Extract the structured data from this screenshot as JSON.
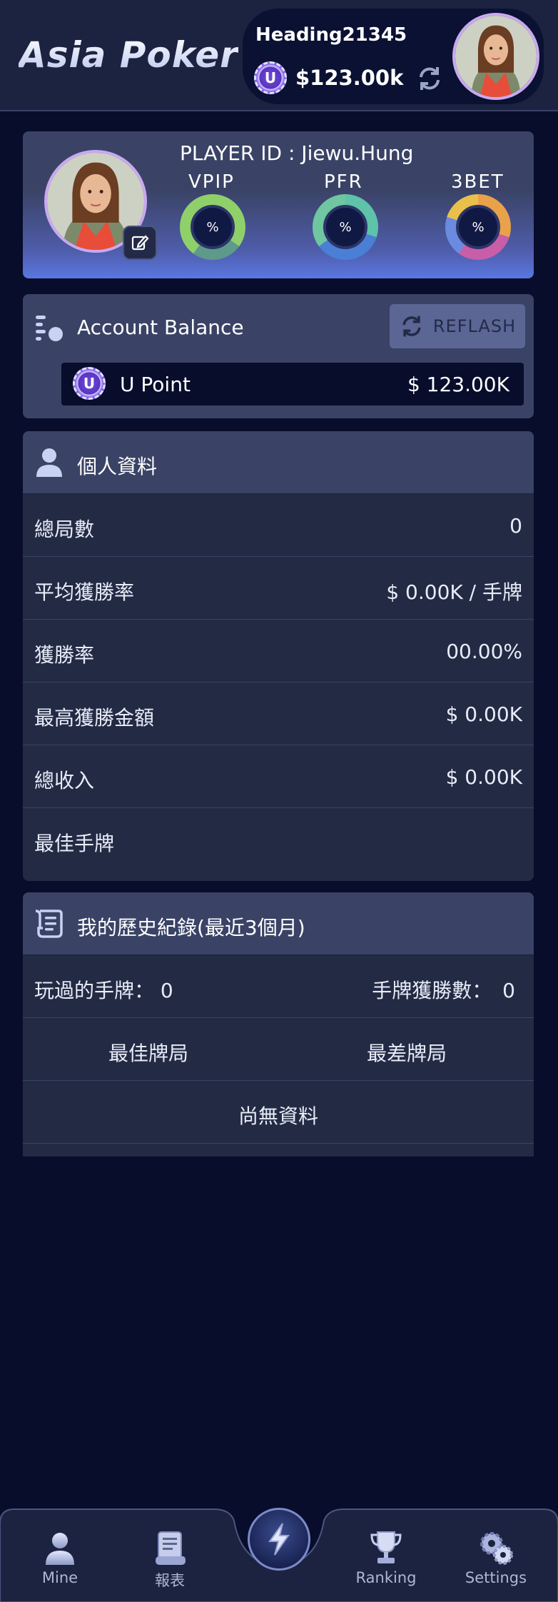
{
  "header": {
    "logo": "Asia Poker",
    "username": "Heading21345",
    "balance": "$123.00k",
    "coin_letter": "U"
  },
  "player": {
    "id_label": "PLAYER ID : Jiewu.Hung",
    "stats": [
      {
        "label": "VPIP",
        "value": "%",
        "ring_color": "#8fd06a"
      },
      {
        "label": "PFR",
        "value": "%",
        "ring_color": "#5ec3a8"
      },
      {
        "label": "3BET",
        "value": "%",
        "ring_color": "#e9a24a"
      }
    ]
  },
  "balance": {
    "title": "Account Balance",
    "reflash_label": "REFLASH",
    "point_name": "U Point",
    "point_value": "$ 123.00K",
    "coin_letter": "U"
  },
  "profile": {
    "title": "個人資料",
    "rows": [
      {
        "label": "總局數",
        "value": "0"
      },
      {
        "label": "平均獲勝率",
        "value": "$ 0.00K / 手牌"
      },
      {
        "label": "獲勝率",
        "value": "00.00%"
      },
      {
        "label": "最高獲勝金額",
        "value": "$ 0.00K"
      },
      {
        "label": "總收入",
        "value": "$ 0.00K"
      },
      {
        "label": "最佳手牌",
        "value": ""
      }
    ]
  },
  "history": {
    "title": "我的歷史紀錄(最近3個月)",
    "played_label": "玩過的手牌：",
    "played_value": "0",
    "won_label": "手牌獲勝數：",
    "won_value": "0",
    "best_label": "最佳牌局",
    "worst_label": "最差牌局",
    "empty_label": "尚無資料"
  },
  "nav": {
    "items": [
      {
        "label": "Mine",
        "icon": "person-icon"
      },
      {
        "label": "報表",
        "icon": "scroll-icon"
      },
      {
        "label": "Ranking",
        "icon": "trophy-icon"
      },
      {
        "label": "Settings",
        "icon": "gears-icon"
      }
    ],
    "center_icon": "lightning-icon"
  },
  "colors": {
    "background": "#070d2b",
    "card": "#3a4366",
    "panel": "#232a44",
    "accent_purple": "#c9a9ef"
  }
}
